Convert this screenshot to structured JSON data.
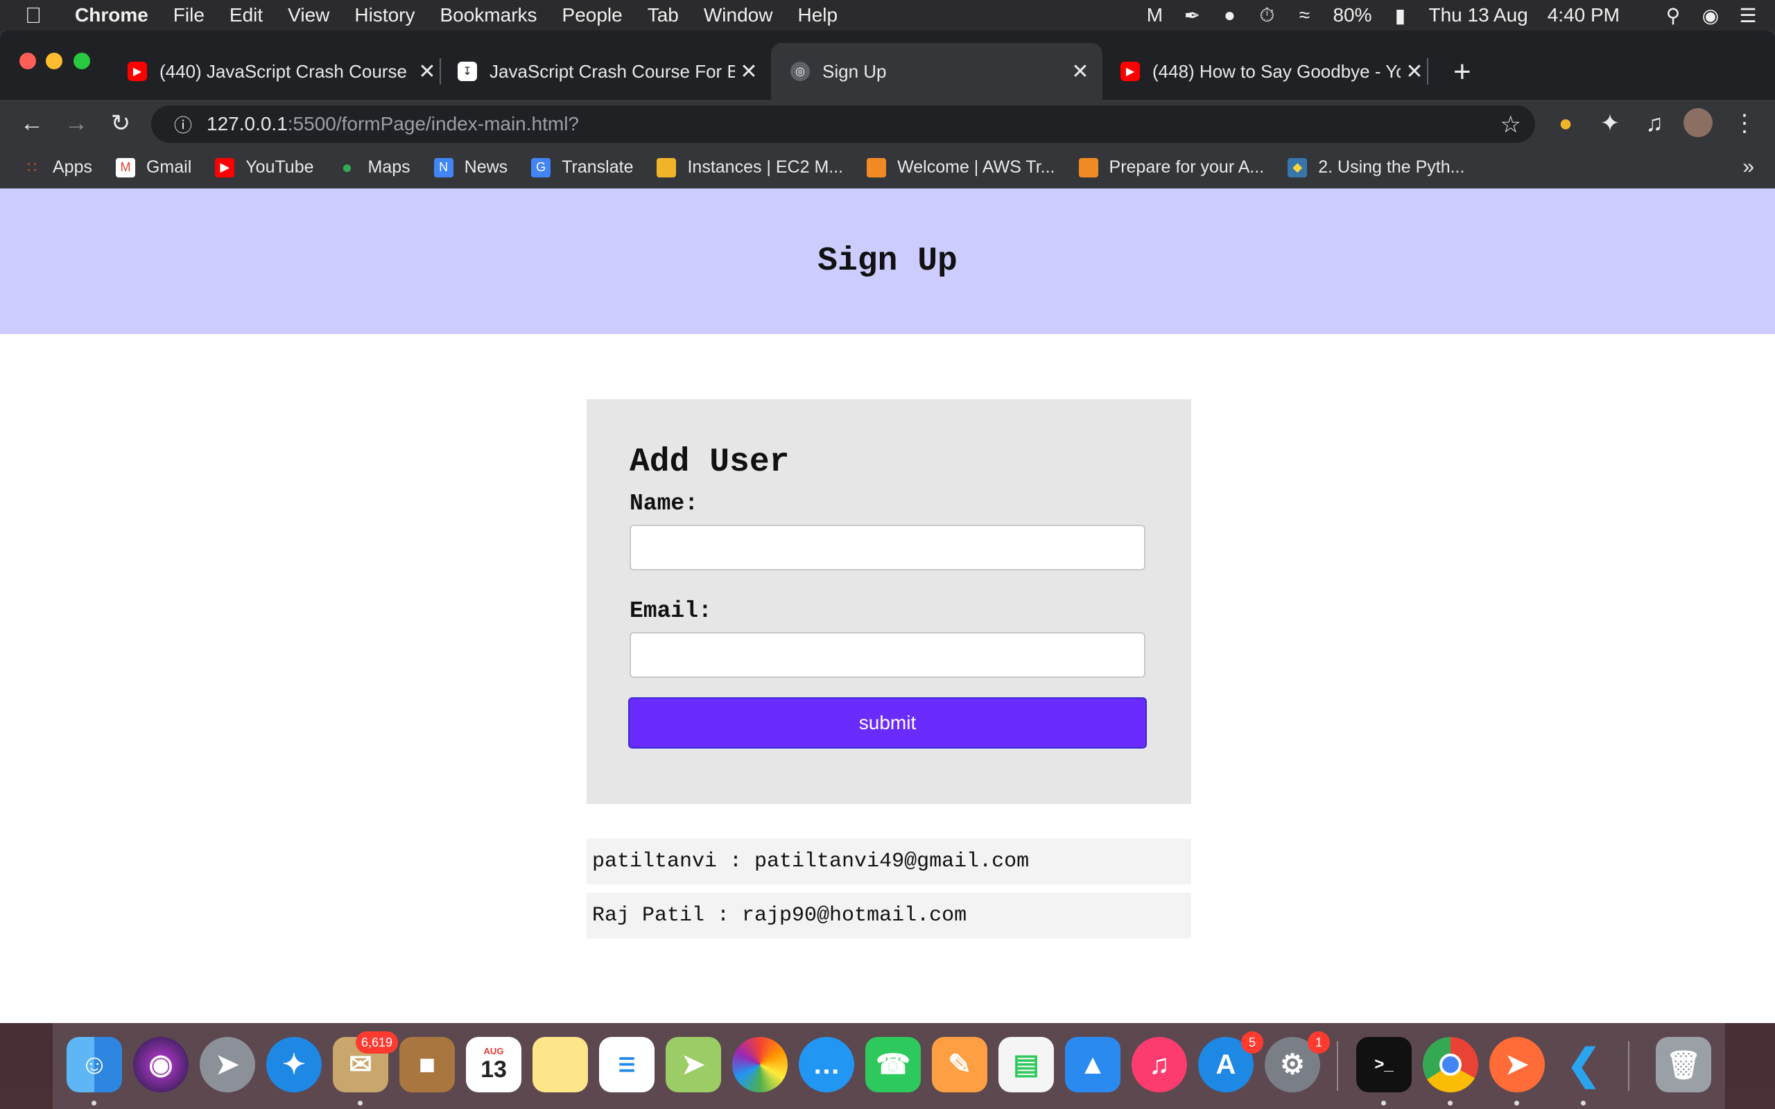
{
  "menubar": {
    "app_name": "Chrome",
    "items": [
      "File",
      "Edit",
      "View",
      "History",
      "Bookmarks",
      "People",
      "Tab",
      "Window",
      "Help"
    ],
    "battery": "80%",
    "date": "Thu 13 Aug",
    "time": "4:40 PM"
  },
  "tabs": [
    {
      "title": "(440) JavaScript Crash Course",
      "icon": "youtube-icon"
    },
    {
      "title": "JavaScript Crash Course For Be",
      "icon": "download-icon"
    },
    {
      "title": "Sign Up",
      "icon": "globe-icon",
      "active": true
    },
    {
      "title": "(448) How to Say Goodbye - Yo",
      "icon": "youtube-icon"
    }
  ],
  "omnibox": {
    "host": "127.0.0.1",
    "path": ":5500/formPage/index-main.html?"
  },
  "bookmarks": [
    {
      "label": "Apps",
      "icon": "apps-grid-icon"
    },
    {
      "label": "Gmail",
      "icon": "gmail-icon"
    },
    {
      "label": "YouTube",
      "icon": "youtube-icon"
    },
    {
      "label": "Maps",
      "icon": "maps-icon"
    },
    {
      "label": "News",
      "icon": "news-icon"
    },
    {
      "label": "Translate",
      "icon": "translate-icon"
    },
    {
      "label": "Instances | EC2 M...",
      "icon": "aws-box-icon"
    },
    {
      "label": "Welcome | AWS Tr...",
      "icon": "aws-cube-icon"
    },
    {
      "label": "Prepare for your A...",
      "icon": "aws-cube-icon"
    },
    {
      "label": "2. Using the Pyth...",
      "icon": "python-icon"
    }
  ],
  "page": {
    "header_title": "Sign Up",
    "form": {
      "title": "Add User",
      "name_label": "Name:",
      "name_value": "",
      "email_label": "Email:",
      "email_value": "",
      "submit_label": "submit"
    },
    "users": [
      "patiltanvi : patiltanvi49@gmail.com",
      "Raj Patil : rajp90@hotmail.com"
    ]
  },
  "dock": {
    "apps": [
      "Finder",
      "Siri",
      "Launchpad",
      "Safari",
      "Mail",
      "Contacts",
      "Calendar",
      "Notes",
      "Reminders",
      "Maps",
      "Photos",
      "Messages",
      "FaceTime",
      "Pages",
      "Numbers",
      "Keynote",
      "Music",
      "App Store",
      "System Preferences",
      "Terminal",
      "Chrome",
      "Postman",
      "VS Code",
      "Trash"
    ],
    "mail_badge": "6,619",
    "appstore_badge": "5",
    "sysprefs_badge": "1",
    "calendar_month": "AUG",
    "calendar_day": "13"
  },
  "colors": {
    "header_bg": "#ccccff",
    "card_bg": "#e6e6e6",
    "submit_bg": "#6a2bff",
    "user_row_bg": "#f3f3f3"
  }
}
